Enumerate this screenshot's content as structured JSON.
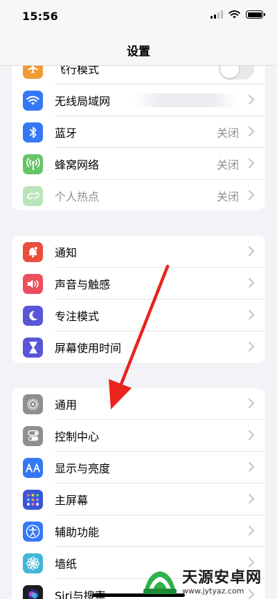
{
  "status_bar": {
    "time": "15:56"
  },
  "nav": {
    "title": "设置"
  },
  "group1": {
    "rows": [
      {
        "label": "飞行模式",
        "icon": "airplane-icon"
      },
      {
        "label": "无线局域网",
        "icon": "wifi-icon"
      },
      {
        "label": "蓝牙",
        "value": "关闭",
        "icon": "bluetooth-icon"
      },
      {
        "label": "蜂窝网络",
        "value": "关闭",
        "icon": "cellular-icon"
      },
      {
        "label": "个人热点",
        "value": "关闭",
        "icon": "hotspot-icon"
      }
    ]
  },
  "group2": {
    "rows": [
      {
        "label": "通知",
        "icon": "notifications-icon"
      },
      {
        "label": "声音与触感",
        "icon": "sound-icon"
      },
      {
        "label": "专注模式",
        "icon": "moon-icon"
      },
      {
        "label": "屏幕使用时间",
        "icon": "hourglass-icon"
      }
    ]
  },
  "group3": {
    "rows": [
      {
        "label": "通用",
        "icon": "gear-icon"
      },
      {
        "label": "控制中心",
        "icon": "toggles-icon"
      },
      {
        "label": "显示与亮度",
        "icon": "text-size-icon"
      },
      {
        "label": "主屏幕",
        "icon": "home-grid-icon"
      },
      {
        "label": "辅助功能",
        "icon": "accessibility-icon"
      },
      {
        "label": "墙纸",
        "icon": "flower-icon"
      },
      {
        "label": "Siri与搜索",
        "icon": "siri-icon"
      }
    ]
  },
  "colors": {
    "airplane": "#f09a37",
    "wifi": "#3478f6",
    "bluetooth": "#3478f6",
    "cellular": "#65c466",
    "hotspot": "#65c466",
    "notifications": "#eb4e3d",
    "sound": "#eb4e5f",
    "focus": "#5856d6",
    "screen_time": "#5856d6",
    "general": "#8e8e93",
    "control_center": "#8e8e93",
    "display": "#3478f6",
    "home_screen": "#3478f6",
    "accessibility": "#3478f6",
    "wallpaper": "#41b7d8",
    "annotation_arrow": "#e8241c"
  },
  "watermark": {
    "title": "天源安卓网",
    "url": "www.jytyaz.com"
  }
}
